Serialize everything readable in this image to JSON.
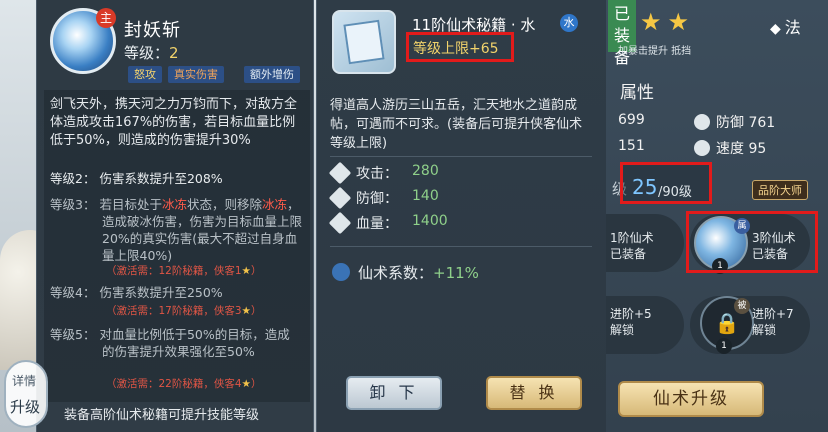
{
  "skill": {
    "main_badge": "主",
    "name": "封妖斩",
    "level_label": "等级：",
    "level_value": "2",
    "tags": [
      "怒攻",
      "真实伤害",
      "额外增伤"
    ],
    "description": "剑飞天外，携天河之力万钧而下，对敌方全体造成攻击167%的伤害，若目标血量比例低于50%，则造成的伤害提升30%",
    "levels": [
      {
        "label": "等级2：",
        "text": "伤害系数提升至208%",
        "active": true
      },
      {
        "label": "等级3：",
        "text_pre": "若目标处于",
        "highlight": "冰冻",
        "text_mid": "状态，则移除",
        "highlight2": "冰冻",
        "text_post": "，造成破冰伤害，伤害为目标血量上限20%的真实伤害(最大不超过自身血量上限40%)",
        "req": "（激活需：12阶秘籍，侠客1",
        "req_end": "）"
      },
      {
        "label": "等级4：",
        "text": "伤害系数提升至250%",
        "req": "（激活需：17阶秘籍，侠客3",
        "req_end": "）"
      },
      {
        "label": "等级5：",
        "text": "对血量比例低于50%的目标，造成的伤害提升效果强化至50%",
        "req": "（激活需：22阶秘籍，侠客4",
        "req_end": "）"
      }
    ],
    "footer": "装备高阶仙术秘籍可提升技能等级",
    "side_detail": "详情",
    "side_upgrade": "升级"
  },
  "item": {
    "title": "11阶仙术秘籍 · 水",
    "water_icon": "水",
    "limit": "等级上限+65",
    "description": "得道高人游历三山五岳，汇天地水之道韵成帖，可遇而不可求。(装备后可提升侠客仙术等级上限)",
    "stats": [
      {
        "label": "攻击：",
        "value": "280"
      },
      {
        "label": "防御：",
        "value": "140"
      },
      {
        "label": "血量：",
        "value": "1400"
      }
    ],
    "coef_label": "仙术系数：",
    "coef_value": "+11%",
    "unload_label": "卸 下",
    "replace_label": "替 换"
  },
  "character": {
    "equipped_tag": "已装备",
    "fa_label": "法",
    "small_note": "加暴击提升 抵挡",
    "attr_title": "属性",
    "stats": [
      {
        "value": "699"
      },
      {
        "label": "防御",
        "value": "761"
      },
      {
        "value": "151"
      },
      {
        "label": "速度",
        "value": "95"
      }
    ],
    "level_prefix": "级",
    "level_current": "25",
    "level_max": "/90级",
    "master_badge": "品阶大师",
    "slots": [
      {
        "text1": "1阶仙术",
        "text2": "已装备"
      },
      {
        "text1": "3阶仙术",
        "text2": "已装备",
        "badge": "1",
        "corner": "属"
      },
      {
        "text1": "进阶+5",
        "text2": "解锁"
      },
      {
        "text1": "进阶+7",
        "text2": "解锁",
        "badge": "1",
        "corner": "被"
      }
    ],
    "upgrade_label": "仙术升级"
  },
  "colors": {
    "highlight_red": "#e21b1b",
    "gold": "#f2d36b",
    "green_value": "#8fd08a"
  }
}
